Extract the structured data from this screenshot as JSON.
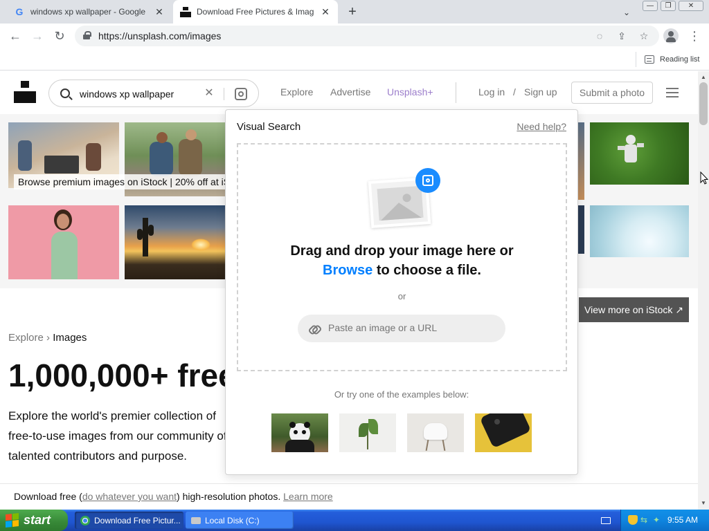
{
  "browser": {
    "tabs": [
      {
        "title": "windows xp wallpaper - Google Search",
        "favicon": "google-icon",
        "active": false
      },
      {
        "title": "Download Free Pictures & Images [",
        "favicon": "unsplash-icon",
        "active": true
      }
    ],
    "url": "https://unsplash.com/images",
    "reading_list": "Reading list"
  },
  "site": {
    "search_value": "windows xp wallpaper",
    "nav": {
      "explore": "Explore",
      "advertise": "Advertise",
      "unsplash_plus": "Unsplash+",
      "login": "Log in",
      "slash": "/",
      "signup": "Sign up",
      "submit": "Submit a photo"
    },
    "istock": {
      "label": "Browse premium images on iStock | 20% off at iS",
      "view_more": "View more on iStock ↗"
    },
    "breadcrumb": {
      "parent": "Explore",
      "sep": "›",
      "current": "Images"
    },
    "hero_title": "1,000,000+ free",
    "hero_desc": "Explore the world's premier collection of free-to-use images from our community of talented contributors and purpose.",
    "footer": {
      "prefix": "Download free (",
      "link1": "do whatever you want",
      "mid": ") high-resolution photos. ",
      "link2": "Learn more"
    }
  },
  "visual_search": {
    "title": "Visual Search",
    "help": "Need help?",
    "drag_line1": "Drag and drop your image here or",
    "browse": "Browse",
    "drag_line2": " to choose a file.",
    "or": "or",
    "url_placeholder": "Paste an image or a URL",
    "examples_label": "Or try one of the examples below:",
    "examples": [
      "panda",
      "plant",
      "chair",
      "phone"
    ]
  },
  "taskbar": {
    "start": "start",
    "tasks": [
      {
        "label": "Download Free Pictur...",
        "active": true
      },
      {
        "label": "Local Disk (C:)",
        "active": false
      }
    ],
    "clock": "9:55 AM"
  },
  "colors": {
    "accent_blue": "#007fff",
    "unsplash_plus_purple": "#9c7ecb",
    "xp_taskbar": "#245edb",
    "xp_start_green": "#378837"
  }
}
